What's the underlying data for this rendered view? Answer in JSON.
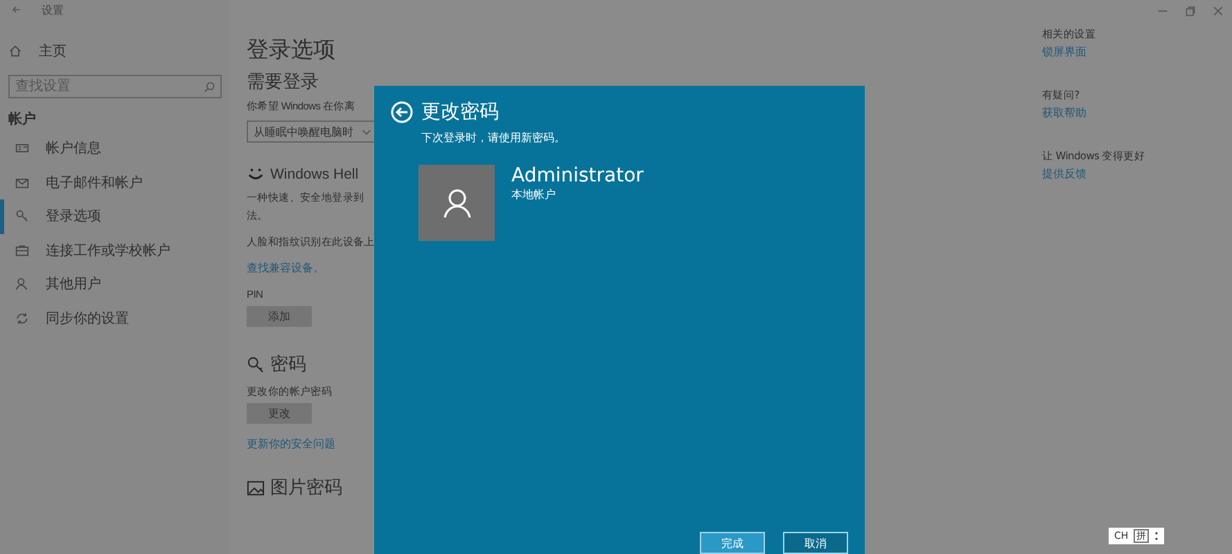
{
  "window": {
    "title": "设置"
  },
  "sidebar": {
    "home": "主页",
    "search": {
      "placeholder": "查找设置"
    },
    "section": "帐户",
    "items": [
      {
        "label": "帐户信息",
        "selected": false
      },
      {
        "label": "电子邮件和帐户",
        "selected": false
      },
      {
        "label": "登录选项",
        "selected": true
      },
      {
        "label": "连接工作或学校帐户",
        "selected": false
      },
      {
        "label": "其他用户",
        "selected": false
      },
      {
        "label": "同步你的设置",
        "selected": false
      }
    ]
  },
  "content": {
    "title": "登录选项",
    "require_signin": {
      "heading": "需要登录",
      "question": "你希望 Windows 在你离",
      "dropdown": "从睡眠中唤醒电脑时"
    },
    "hello": {
      "heading": "Windows Hell",
      "desc_1": "一种快速、安全地登录到",
      "desc_2": "法。",
      "note": "人脸和指纹识别在此设备上",
      "link": "查找兼容设备。"
    },
    "pin": {
      "label": "PIN",
      "button": "添加"
    },
    "password": {
      "heading": "密码",
      "desc": "更改你的帐户密码",
      "button": "更改",
      "link": "更新你的安全问题"
    },
    "picture_password": {
      "heading": "图片密码"
    }
  },
  "related": [
    {
      "heading": "相关的设置",
      "link": "锁屏界面"
    },
    {
      "heading": "有疑问?",
      "link": "获取帮助"
    },
    {
      "heading": "让 Windows 变得更好",
      "link": "提供反馈"
    }
  ],
  "dialog": {
    "title": "更改密码",
    "subtitle": "下次登录时，请使用新密码。",
    "user": "Administrator",
    "account_type": "本地帐户",
    "buttons": [
      {
        "label": "完成",
        "primary": true
      },
      {
        "label": "取消",
        "primary": false
      }
    ]
  },
  "ime": {
    "language": "CH",
    "mode": "拼"
  }
}
